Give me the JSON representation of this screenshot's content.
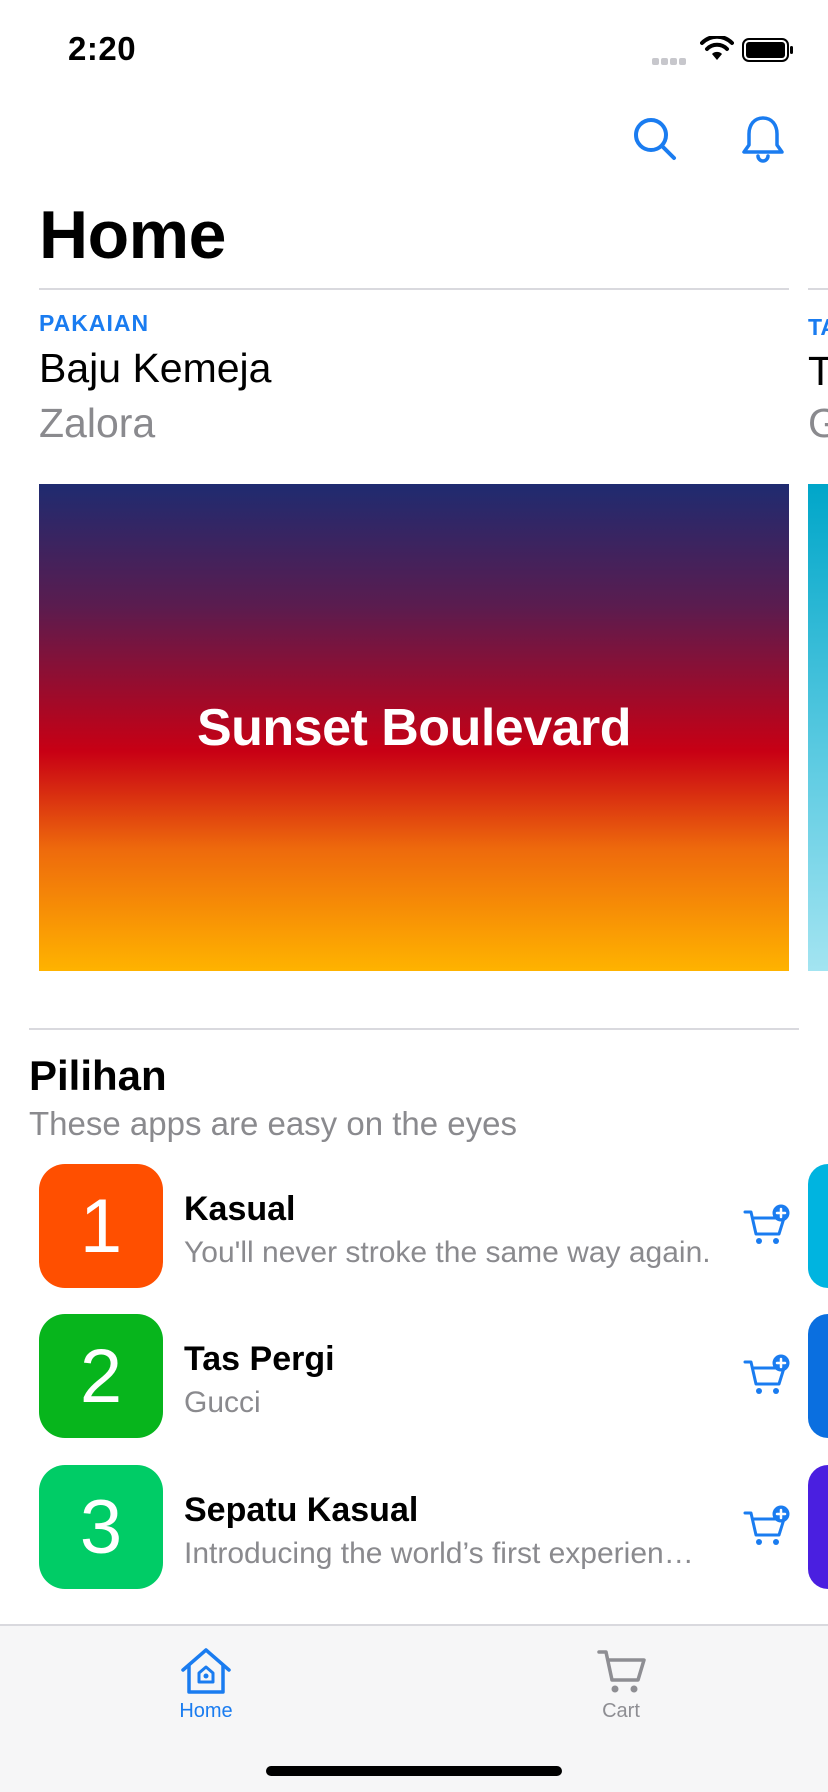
{
  "status_bar": {
    "time": "2:20"
  },
  "header": {
    "title": "Home"
  },
  "featured": {
    "category": "PAKAIAN",
    "name": "Baju Kemeja",
    "brand": "Zalora",
    "banner_text": "Sunset Boulevard",
    "peek": {
      "category": "TA",
      "name": "T",
      "brand": "G"
    }
  },
  "section": {
    "title": "Pilihan",
    "subtitle": "These apps are easy on the eyes",
    "items": [
      {
        "rank": "1",
        "name": "Kasual",
        "description": "You'll never stroke the same way again.",
        "color": "#ff4f00"
      },
      {
        "rank": "2",
        "name": "Tas Pergi",
        "description": "Gucci",
        "color": "#07b51c"
      },
      {
        "rank": "3",
        "name": "Sepatu Kasual",
        "description": "Introducing the world’s first experien…",
        "color": "#00cc66"
      }
    ],
    "peek_colors": [
      "#00b4e0",
      "#0a6fe0",
      "#4a1fe0"
    ]
  },
  "tab_bar": {
    "tabs": [
      {
        "label": "Home",
        "icon": "home-icon",
        "active": true
      },
      {
        "label": "Cart",
        "icon": "cart-icon",
        "active": false
      }
    ]
  },
  "colors": {
    "accent": "#1a7cf0",
    "secondary_text": "#8a8a8e"
  }
}
